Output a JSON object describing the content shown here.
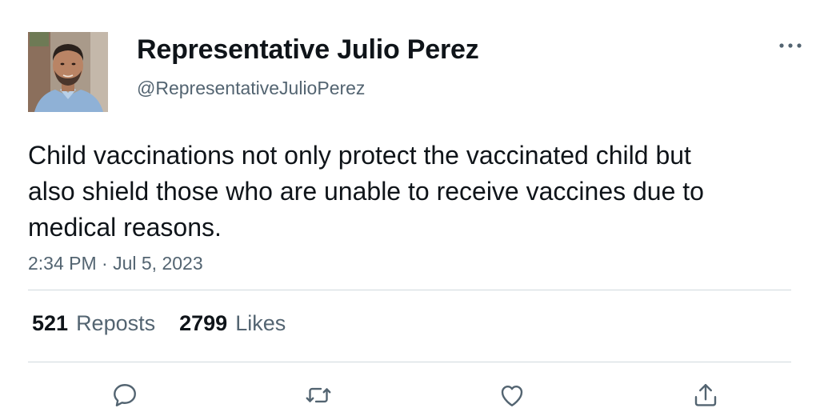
{
  "author": {
    "display_name": "Representative Julio Perez",
    "handle": "@RepresentativeJulioPerez",
    "avatar": "profile-photo-man-blue-shirt"
  },
  "tweet": {
    "text": "Child vaccinations not only protect the vaccinated child but also shield those who are unable to receive vaccines due to medical reasons.",
    "timestamp": "2:34 PM · Jul 5, 2023"
  },
  "stats": {
    "reposts_count": "521",
    "reposts_label": "Reposts",
    "likes_count": "2799",
    "likes_label": "Likes"
  },
  "actions": [
    {
      "name": "reply",
      "icon": "speech-bubble-icon"
    },
    {
      "name": "repost",
      "icon": "repost-arrows-icon"
    },
    {
      "name": "like",
      "icon": "heart-icon"
    },
    {
      "name": "share",
      "icon": "share-upload-icon"
    }
  ],
  "more_icon": "more-horizontal-icon",
  "colors": {
    "text_primary": "#0f1419",
    "text_secondary": "#536471",
    "divider": "#cfd9de",
    "background": "#ffffff"
  }
}
